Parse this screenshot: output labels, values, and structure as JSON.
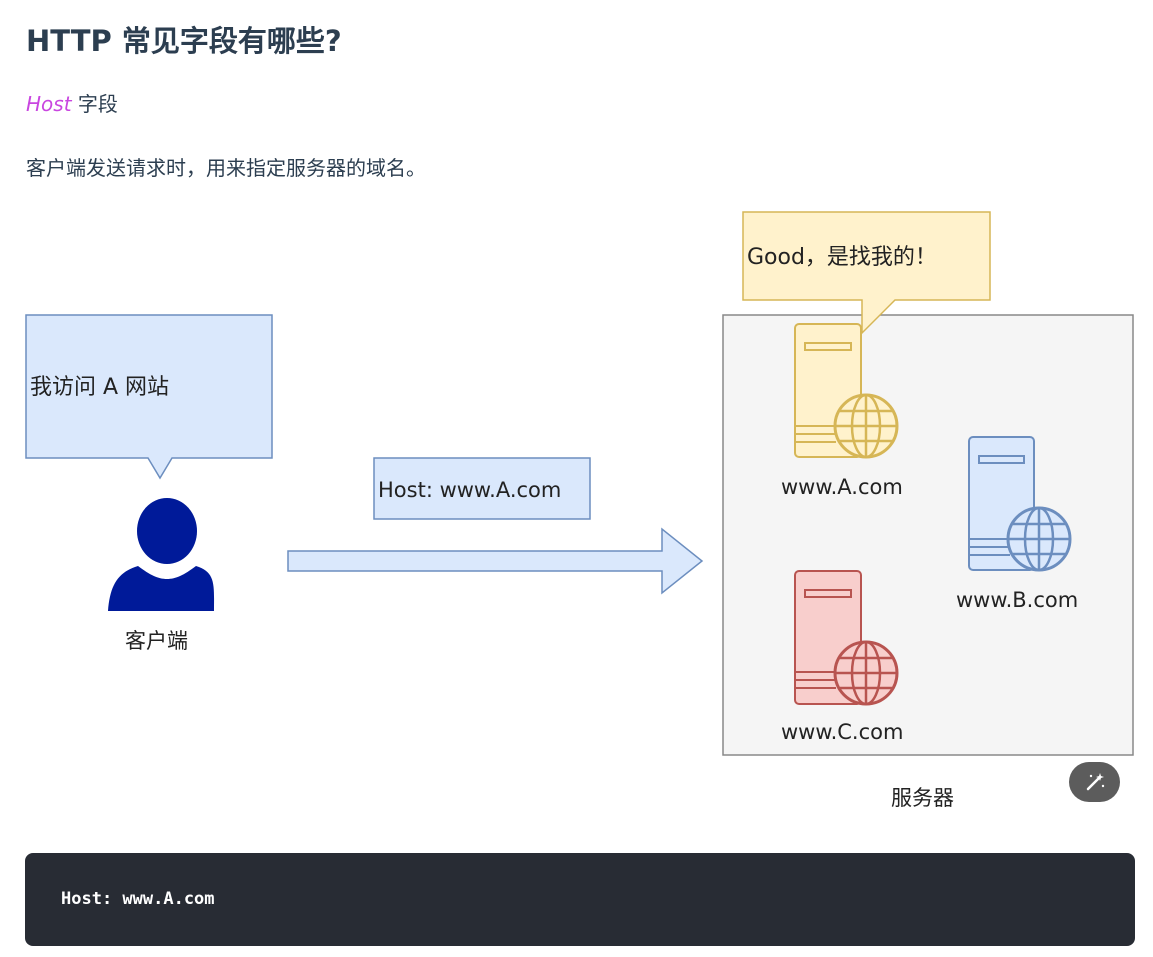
{
  "heading": "HTTP 常见字段有哪些?",
  "host_field": {
    "name": "Host",
    "suffix": " 字段"
  },
  "description": "客户端发送请求时，用来指定服务器的域名。",
  "diagram": {
    "client_bubble": "我访问 A 网站",
    "client_label": "客户端",
    "host_header": "Host: www.A.com",
    "server_bubble": "Good，是找我的！",
    "server_a": "www.A.com",
    "server_b": "www.B.com",
    "server_c": "www.C.com",
    "servers_label": "服务器"
  },
  "code": "Host: www.A.com",
  "colors": {
    "accent_italic": "#c946e0",
    "code_bg": "#282c34",
    "blue_fill": "#dae8fc",
    "blue_stroke": "#6c8ebf",
    "yellow_fill": "#fff2cc",
    "yellow_stroke": "#d6b656",
    "red_fill": "#f8cecc",
    "red_stroke": "#b85450",
    "user_icon": "#001a99"
  },
  "icons": [
    "user-icon",
    "server-icon",
    "globe-icon",
    "magic-wand-icon"
  ]
}
